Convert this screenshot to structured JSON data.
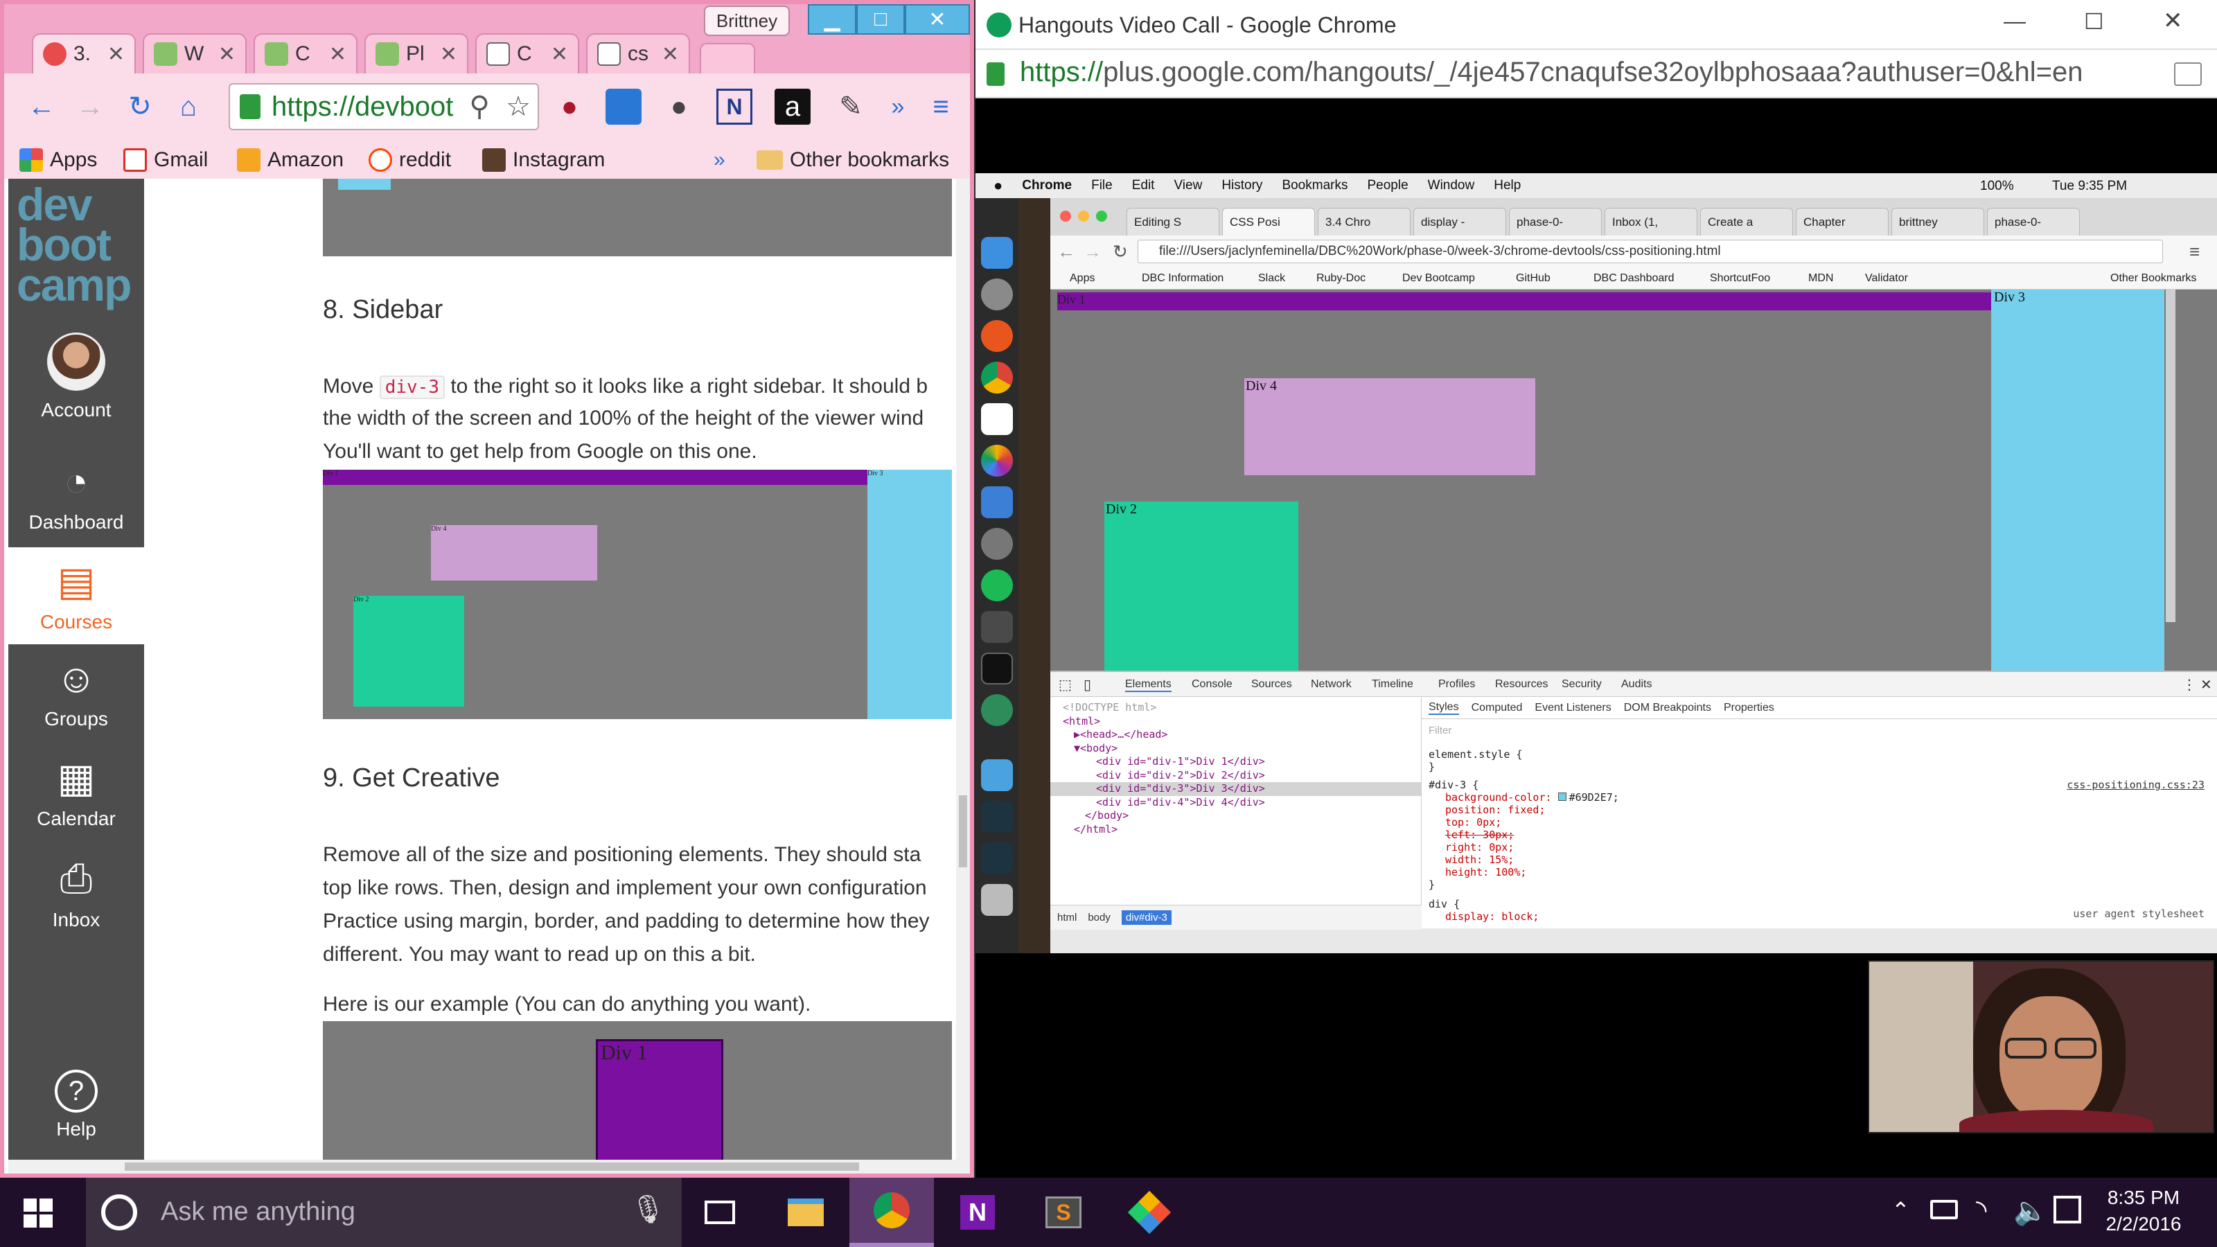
{
  "left_window": {
    "profile_name": "Brittney",
    "tabs": [
      {
        "label": "3.",
        "fav": "#e84b4b"
      },
      {
        "label": "W",
        "fav": "#89c06a"
      },
      {
        "label": "C",
        "fav": "#89c06a"
      },
      {
        "label": "Pl",
        "fav": "#89c06a"
      },
      {
        "label": "C",
        "fav": "#ffffff"
      },
      {
        "label": "cs",
        "fav": "#ffffff"
      }
    ],
    "tab_close": "✕",
    "omnibox": "https://devboot",
    "bookmarks": [
      {
        "label": "Apps",
        "color": "#e84b4b"
      },
      {
        "label": "Gmail",
        "color": "#d93025"
      },
      {
        "label": "Amazon",
        "color": "#f5a623"
      },
      {
        "label": "reddit",
        "color": "#ff4500"
      },
      {
        "label": "Instagram",
        "color": "#5a3e2b"
      }
    ],
    "bookmarks_more": "»",
    "other_bookmarks": "Other bookmarks",
    "sidebar": {
      "logo": [
        "dev",
        "boot",
        "camp"
      ],
      "items": [
        {
          "label": "Account",
          "icon": "avatar"
        },
        {
          "label": "Dashboard",
          "icon": "gauge-icon"
        },
        {
          "label": "Courses",
          "icon": "notebook-icon"
        },
        {
          "label": "Groups",
          "icon": "users-icon"
        },
        {
          "label": "Calendar",
          "icon": "calendar-icon"
        },
        {
          "label": "Inbox",
          "icon": "inbox-icon"
        },
        {
          "label": "Help",
          "icon": "help-icon"
        }
      ]
    },
    "content": {
      "sec8_title": "8. Sidebar",
      "sec8_p1_pre": "Move ",
      "sec8_code": "div-3",
      "sec8_p1_post": " to the right so it looks like a right sidebar. It should b",
      "sec8_p2": "the width of the screen and 100% of the height of the viewer wind",
      "sec8_p3": "You'll want to get help from Google on this one.",
      "demo_labels": {
        "div1": "Div 1",
        "div2": "Div 2",
        "div3": "Div 3",
        "div4": "Div 4"
      },
      "sec9_title": "9. Get Creative",
      "sec9_p1": "Remove all of the size and positioning elements. They should sta",
      "sec9_p2": "top like rows. Then, design and implement your own configuration",
      "sec9_p3": "Practice using margin, border, and padding to determine how they",
      "sec9_p4": "different. You may want to read up on this a bit.",
      "example_caption": "Here is our example (You can do anything you want).",
      "example_label": "Div 1"
    }
  },
  "right_window": {
    "title": "Hangouts Video Call - Google Chrome",
    "url_secure": "https://",
    "url_rest": "plus.google.com/hangouts/_/4je457cnaqufse32oylbphosaaa?authuser=0&hl=en",
    "mac_menu": [
      "Chrome",
      "File",
      "Edit",
      "View",
      "History",
      "Bookmarks",
      "People",
      "Window",
      "Help"
    ],
    "mac_status": "100%",
    "mac_clock": "Tue 9:35 PM",
    "inner_tabs": [
      "Editing S",
      "CSS Posi",
      "3.4 Chro",
      "display -",
      "phase-0-",
      "Inbox (1,",
      "Create a",
      "Chapter",
      "brittney",
      "phase-0-"
    ],
    "inner_url": "file:///Users/jaclynfeminella/DBC%20Work/phase-0/week-3/chrome-devtools/css-positioning.html",
    "inner_bookmarks": [
      "Apps",
      "DBC Information",
      "Slack",
      "Ruby-Doc",
      "Dev Bootcamp",
      "GitHub",
      "DBC Dashboard",
      "ShortcutFoo",
      "MDN",
      "Validator"
    ],
    "inner_other_bookmarks": "Other Bookmarks",
    "inner_div_labels": {
      "div1": "Div 1",
      "div2": "Div 2",
      "div3": "Div 3",
      "div4": "Div 4"
    },
    "devtools": {
      "tabs": [
        "Elements",
        "Console",
        "Sources",
        "Network",
        "Timeline",
        "Profiles",
        "Resources",
        "Security",
        "Audits"
      ],
      "dom_lines": [
        "<!DOCTYPE html>",
        "<html>",
        "▶<head>…</head>",
        "▼<body>",
        "<div id=\"div-1\">Div 1</div>",
        "<div id=\"div-2\">Div 2</div>",
        "<div id=\"div-3\">Div 3</div>",
        "<div id=\"div-4\">Div 4</div>",
        "</body>",
        "</html>"
      ],
      "style_tabs": [
        "Styles",
        "Computed",
        "Event Listeners",
        "DOM Breakpoints",
        "Properties"
      ],
      "filter": "Filter",
      "element_style": "element.style {",
      "close_brace": "}",
      "rule_selector": "#div-3 {",
      "rule_source": "css-positioning.css:23",
      "rule_props": [
        "background-color: ",
        "position: fixed;",
        "top: 0px;",
        "left: 30px;",
        "right: 0px;",
        "width: 15%;",
        "height: 100%;"
      ],
      "bg_value": "#69D2E7;",
      "ua_label": "user agent stylesheet",
      "ua_selector": "div {",
      "ua_prop": "display: block;",
      "breadcrumbs": [
        "html",
        "body",
        "div#div-3"
      ]
    }
  },
  "taskbar": {
    "search_placeholder": "Ask me anything",
    "time": "8:35 PM",
    "date": "2/2/2016"
  },
  "colors": {
    "purple": "#7b0fa0",
    "lavender": "#cc9fd2",
    "teal": "#1fce9a",
    "sky": "#74d0ec",
    "gray": "#7b7b7b",
    "orange": "#f26522"
  }
}
